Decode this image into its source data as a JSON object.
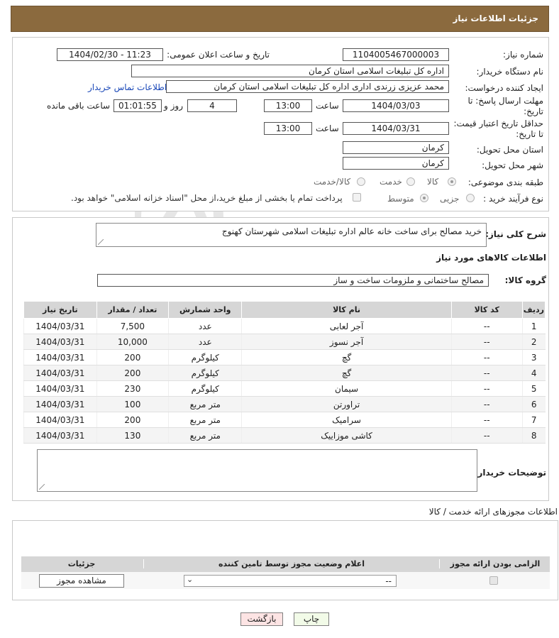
{
  "header": {
    "title": "جزئیات اطلاعات نیاز"
  },
  "need": {
    "number_label": "شماره نیاز:",
    "number": "1104005467000003",
    "announce_label": "تاریخ و ساعت اعلان عمومی:",
    "announce_value": "1404/02/30 - 11:23",
    "buyer_label": "نام دستگاه خریدار:",
    "buyer_value": "اداره کل تبلیغات اسلامی استان کرمان",
    "creator_label": "ایجاد کننده درخواست:",
    "creator_value": "محمد عزیزی زرندی اداری اداره کل تبلیغات اسلامی استان کرمان",
    "contact_link": "اطلاعات تماس خریدار",
    "deadline_label": "مهلت ارسال پاسخ: تا تاریخ:",
    "deadline_date": "1404/03/03",
    "time_label": "ساعت",
    "deadline_time": "13:00",
    "days_value": "4",
    "days_label": "روز و",
    "remaining_value": "01:01:55",
    "remaining_label": "ساعت باقی مانده",
    "validity_label": "حداقل تاریخ اعتبار قیمت: تا تاریخ:",
    "validity_date": "1404/03/31",
    "validity_time": "13:00",
    "province_label": "استان محل تحویل:",
    "province_value": "کرمان",
    "city_label": "شهر محل تحویل:",
    "city_value": "کرمان",
    "category_label": "طبقه بندی موضوعی:",
    "category_options": [
      "کالا",
      "خدمت",
      "کالا/خدمت"
    ],
    "category_selected": "کالا",
    "process_label": "نوع فرآیند خرید :",
    "process_options": [
      "جزیی",
      "متوسط"
    ],
    "process_selected": "متوسط",
    "payment_note": "پرداخت تمام یا بخشی از مبلغ خرید،از محل \"اسناد خزانه اسلامی\" خواهد بود."
  },
  "description": {
    "label": "شرح کلی نیاز:",
    "value": "خرید مصالح برای ساخت خانه عالم اداره تبلیغات اسلامی شهرستان کهنوج"
  },
  "goods": {
    "section_title": "اطلاعات کالاهای مورد نیاز",
    "group_label": "گروه کالا:",
    "group_value": "مصالح ساختمانی و ملزومات ساخت و ساز",
    "columns": [
      "ردیف",
      "کد کالا",
      "نام کالا",
      "واحد شمارش",
      "تعداد / مقدار",
      "تاریخ نیاز"
    ],
    "rows": [
      [
        "1",
        "--",
        "آجر لعابی",
        "عدد",
        "7,500",
        "1404/03/31"
      ],
      [
        "2",
        "--",
        "آجر نسوز",
        "عدد",
        "10,000",
        "1404/03/31"
      ],
      [
        "3",
        "--",
        "گچ",
        "کیلوگرم",
        "200",
        "1404/03/31"
      ],
      [
        "4",
        "--",
        "گچ",
        "کیلوگرم",
        "200",
        "1404/03/31"
      ],
      [
        "5",
        "--",
        "سیمان",
        "کیلوگرم",
        "230",
        "1404/03/31"
      ],
      [
        "6",
        "--",
        "تراورتن",
        "متر مربع",
        "100",
        "1404/03/31"
      ],
      [
        "7",
        "--",
        "سرامیک",
        "متر مربع",
        "200",
        "1404/03/31"
      ],
      [
        "8",
        "--",
        "کاشی موزاییک",
        "متر مربع",
        "130",
        "1404/03/31"
      ]
    ]
  },
  "buyer_notes": {
    "label": "توضیحات خریدار:",
    "value": ""
  },
  "licenses": {
    "title": "اطلاعات مجوزهای ارائه خدمت / کالا",
    "col_required": "الزامی بودن ارائه مجوز",
    "col_status": "اعلام وضعیت مجوز توسط تامین کننده",
    "col_details": "جزئیات",
    "select_value": "--",
    "view_button": "مشاهده مجوز"
  },
  "footer": {
    "print_button": "چاپ",
    "back_button": "بازگشت"
  },
  "colors": {
    "header": "#8b6a3e",
    "link": "#1a48b8",
    "table_header": "#d6d6d6",
    "back_button": "#fde4e4"
  }
}
